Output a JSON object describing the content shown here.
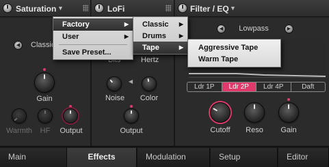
{
  "modules": [
    {
      "title": "Saturation"
    },
    {
      "title": "LoFi"
    },
    {
      "title": "Filter / EQ"
    }
  ],
  "saturation": {
    "mode_label": "Classic",
    "knobs": {
      "gain": "Gain",
      "warmth": "Warmth",
      "hf": "HF",
      "output": "Output"
    }
  },
  "lofi": {
    "labels": {
      "bits": "Bits",
      "hertz": "Hertz",
      "noise": "Noise",
      "color": "Color",
      "output": "Output"
    }
  },
  "filter": {
    "type_label": "Lowpass",
    "ladder_modes": [
      "Ldr 1P",
      "Ldr 2P",
      "Ldr 4P",
      "Daft"
    ],
    "ladder_selected": "Ldr 2P",
    "knobs": {
      "cutoff": "Cutoff",
      "reso": "Reso",
      "gain": "Gain"
    }
  },
  "tabs": [
    "Main",
    "Effects",
    "Modulation",
    "Setup",
    "Editor"
  ],
  "active_tab": "Effects",
  "menus": {
    "root": [
      "Factory",
      "User",
      "Save Preset..."
    ],
    "factory": [
      "Classic",
      "Drums",
      "Tape"
    ],
    "tape": [
      "Aggressive Tape",
      "Warm Tape"
    ]
  },
  "colors": {
    "accent": "#e03a6c",
    "background": "#232323",
    "menu_bg": "#d6d6d6",
    "menu_highlight": "#3a3a3a"
  }
}
